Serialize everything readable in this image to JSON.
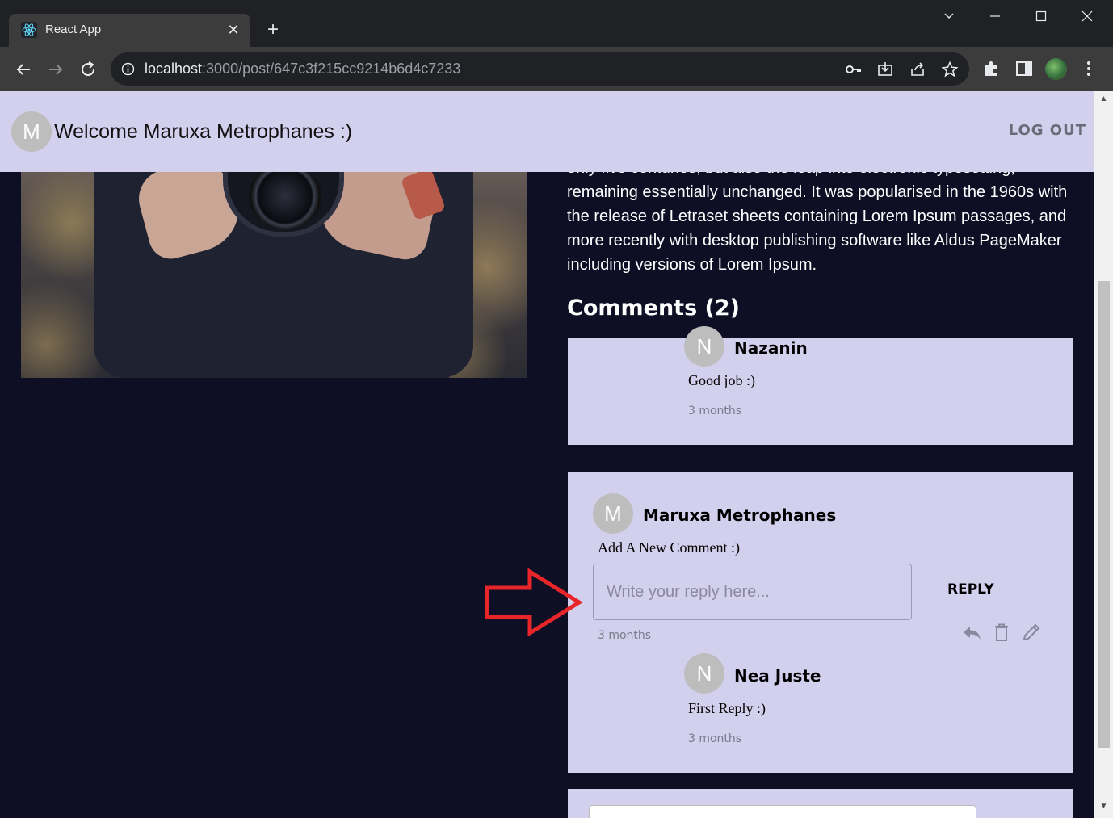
{
  "browser": {
    "tab_title": "React App",
    "url_host": "localhost",
    "url_path": ":3000/post/647c3f215cc9214b6d4c7233"
  },
  "header": {
    "avatar_letter": "M",
    "welcome": "Welcome Maruxa Metrophanes :)",
    "logout": "LOG OUT"
  },
  "article": {
    "cut_line": "only five centuries, but also the leap into electronic typesetting,",
    "text": "remaining essentially unchanged. It was popularised in the 1960s with the release of Letraset sheets containing Lorem Ipsum passages, and more recently with desktop publishing software like Aldus PageMaker including versions of Lorem Ipsum."
  },
  "comments": {
    "title": "Comments (2)",
    "first": {
      "avatar_letter": "N",
      "author": "Nazanin",
      "text": "Good job :)",
      "time": "3 months"
    },
    "second": {
      "avatar_letter": "M",
      "author": "Maruxa Metrophanes",
      "text": "Add A New Comment :)",
      "time": "3 months",
      "reply_placeholder": "Write your reply here...",
      "reply_button": "REPLY",
      "reply": {
        "avatar_letter": "N",
        "author": "Nea Juste",
        "text": "First Reply :)",
        "time": "3 months"
      }
    }
  },
  "colors": {
    "page_bg": "#0e0f24",
    "card_bg": "#d3d0ee",
    "annotation_arrow": "#e8262a"
  }
}
